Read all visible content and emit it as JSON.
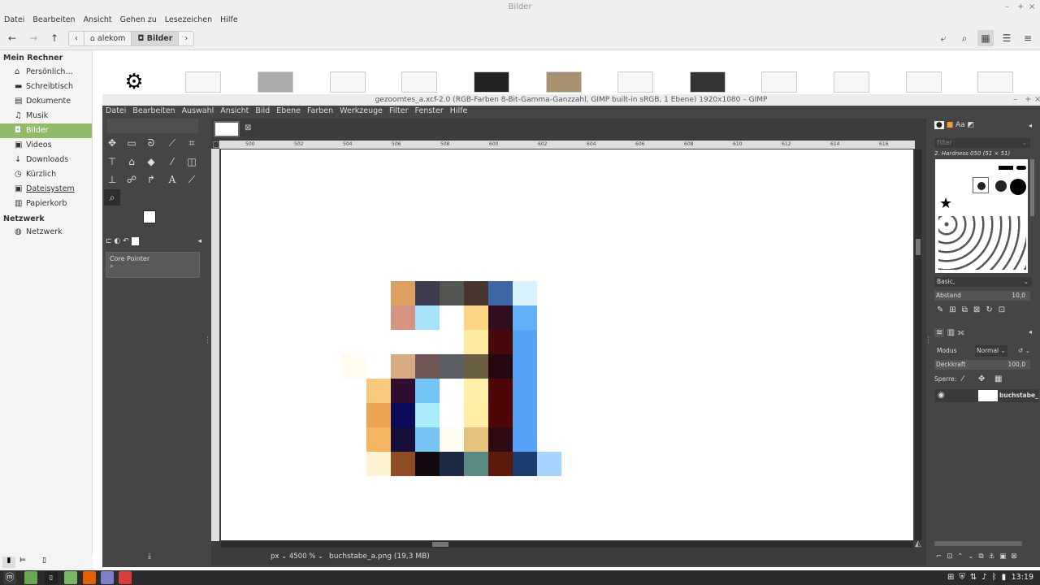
{
  "fm": {
    "title": "Bilder",
    "menu": [
      "Datei",
      "Bearbeiten",
      "Ansicht",
      "Gehen zu",
      "Lesezeichen",
      "Hilfe"
    ],
    "crumbs": [
      "alekom",
      "Bilder"
    ],
    "sidebar_header_computer": "Mein Rechner",
    "sidebar_header_network": "Netzwerk",
    "sidebar": [
      "Persönlich…",
      "Schreibtisch",
      "Dokumente",
      "Musik",
      "Bilder",
      "Videos",
      "Downloads",
      "Kürzlich",
      "Dateisystem",
      "Papierkorb"
    ],
    "network_item": "Netzwerk"
  },
  "gimp": {
    "title": "gezoomtes_a.xcf-2.0 (RGB-Farben 8-Bit-Gamma-Ganzzahl, GIMP built-in sRGB, 1 Ebene) 1920x1080 – GIMP",
    "menu": [
      "Datei",
      "Bearbeiten",
      "Auswahl",
      "Ansicht",
      "Bild",
      "Ebene",
      "Farben",
      "Werkzeuge",
      "Filter",
      "Fenster",
      "Hilfe"
    ],
    "ruler_ticks": [
      "500",
      "502",
      "504",
      "506",
      "508",
      "600",
      "602",
      "604",
      "606",
      "608",
      "610",
      "612",
      "614",
      "616"
    ],
    "core_pointer": "Core Pointer",
    "brush_filter_placeholder": "Filter",
    "brush_name": "2. Hardness 050 (51 × 51)",
    "brush_preset": "Basic,",
    "abstand_label": "Abstand",
    "abstand_value": "10,0",
    "modus_label": "Modus",
    "modus_value": "Normal",
    "deckkraft_label": "Deckkraft",
    "deckkraft_value": "100,0",
    "sperre_label": "Sperre:",
    "layer_name": "buchstabe_a",
    "unit": "px",
    "zoom": "4500 %",
    "status": "buchstabe_a.png (19,3 MB)",
    "pixel_colors": [
      [
        "#ffffff",
        "#ffffff",
        "#dba061",
        "#3c3c4e",
        "#545651",
        "#483530",
        "#3d67a7",
        "#d8f3fd"
      ],
      [
        "#ffffff",
        "#ffffff",
        "#d69583",
        "#a6e2fa",
        "#ffffff",
        "#fdd683",
        "#310d1e",
        "#61b0f8"
      ],
      [
        "#ffffff",
        "#ffffff",
        "#ffffff",
        "#ffffff",
        "#ffffff",
        "#ffeaa1",
        "#470909",
        "#55a2f6"
      ],
      [
        "#fffcef",
        "#ffffff",
        "#d9ab85",
        "#6e5754",
        "#5b5e65",
        "#6a5f43",
        "#260811",
        "#55a2f6"
      ],
      [
        "#ffffff",
        "#f7c97d",
        "#2f0e2f",
        "#74c5f7",
        "#ffffff",
        "#fff0a7",
        "#4e0608",
        "#55a2f6"
      ],
      [
        "#ffffff",
        "#eca450",
        "#0a0b5a",
        "#abecfb",
        "#ffffff",
        "#ffeea4",
        "#4e0608",
        "#55a2f6"
      ],
      [
        "#ffffff",
        "#f4b462",
        "#15103a",
        "#75c4f3",
        "#fffdf2",
        "#e6c27c",
        "#2f0a12",
        "#55a2f6"
      ],
      [
        "#ffffff",
        "#fff3d4",
        "#8e4c24",
        "#140b12",
        "#1c2a43",
        "#5b8a84",
        "#5c1a0c",
        "#1b3d6e",
        "#a7d4fc"
      ]
    ]
  },
  "taskbar": {
    "clock": "13:19"
  }
}
